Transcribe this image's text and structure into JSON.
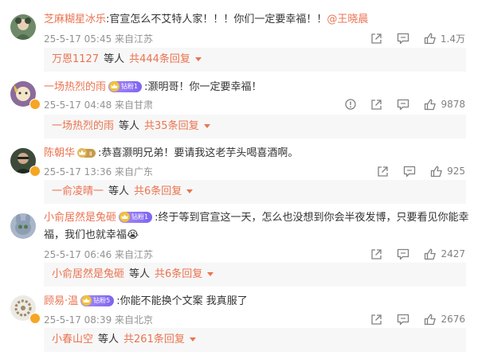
{
  "comments": [
    {
      "user": "芝麻糊星冰乐",
      "text": ":官宣怎么不艾特人家！！！你们一定要幸福！！",
      "mention": "@王晓晨",
      "badge": "",
      "meta": "25-5-17 05:45 来自江苏",
      "likes": "1.4万",
      "has_report_icon": false,
      "reply_user": "万恩1127",
      "reply_mid": "等人",
      "reply_count": "共444条回复"
    },
    {
      "user": "一场热烈的雨",
      "text": ":灏明哥！你一定要幸福！",
      "mention": "",
      "badge": "钻粉1",
      "meta": "25-5-17 04:48 来自甘肃",
      "likes": "9878",
      "has_report_icon": true,
      "reply_user": "一场热烈的雨",
      "reply_mid": "等人",
      "reply_count": "共35条回复"
    },
    {
      "user": "陈朝华",
      "text": ":恭喜灏明兄弟！要请我这老芋头喝喜酒啊。",
      "mention": "",
      "badge": "",
      "meta": "25-5-17 13:36 来自广东",
      "likes": "925",
      "has_report_icon": false,
      "reply_user": "一俞凌晴一",
      "reply_mid": "等人",
      "reply_count": "共6条回复"
    },
    {
      "user": "小俞居然是兔砸",
      "text": ":终于等到官宣这一天，怎么也没想到你会半夜发博，只要看见你能幸",
      "text2": "福，我们也就幸福😭",
      "mention": "",
      "badge": "钻粉1",
      "meta": "25-5-17 06:46 来自江苏",
      "likes": "2427",
      "has_report_icon": false,
      "reply_user": "小俞居然是兔砸",
      "reply_mid": "等人",
      "reply_count": "共6条回复"
    },
    {
      "user": "顾易·温",
      "text": ":你能不能换个文案 我真服了",
      "mention": "",
      "badge": "钻粉5",
      "meta": "25-5-17 08:39 来自北京",
      "likes": "2676",
      "has_report_icon": false,
      "reply_user": "小春山空",
      "reply_mid": "等人",
      "reply_count": "共261条回复"
    }
  ],
  "icons": {
    "share": "share-icon",
    "comment": "comment-icon",
    "like": "like-icon",
    "report": "report-icon"
  },
  "colors": {
    "username": "#eb7350",
    "meta": "#939393",
    "reply_bg": "#f7f7f7"
  }
}
